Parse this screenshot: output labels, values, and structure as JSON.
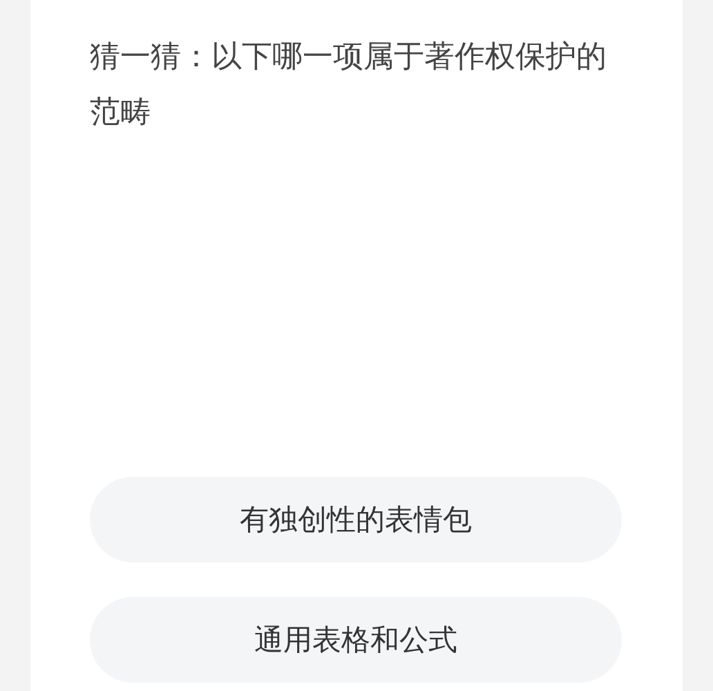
{
  "question": "猜一猜：以下哪一项属于著作权保护的范畴",
  "options": [
    {
      "label": "有独创性的表情包"
    },
    {
      "label": "通用表格和公式"
    }
  ]
}
